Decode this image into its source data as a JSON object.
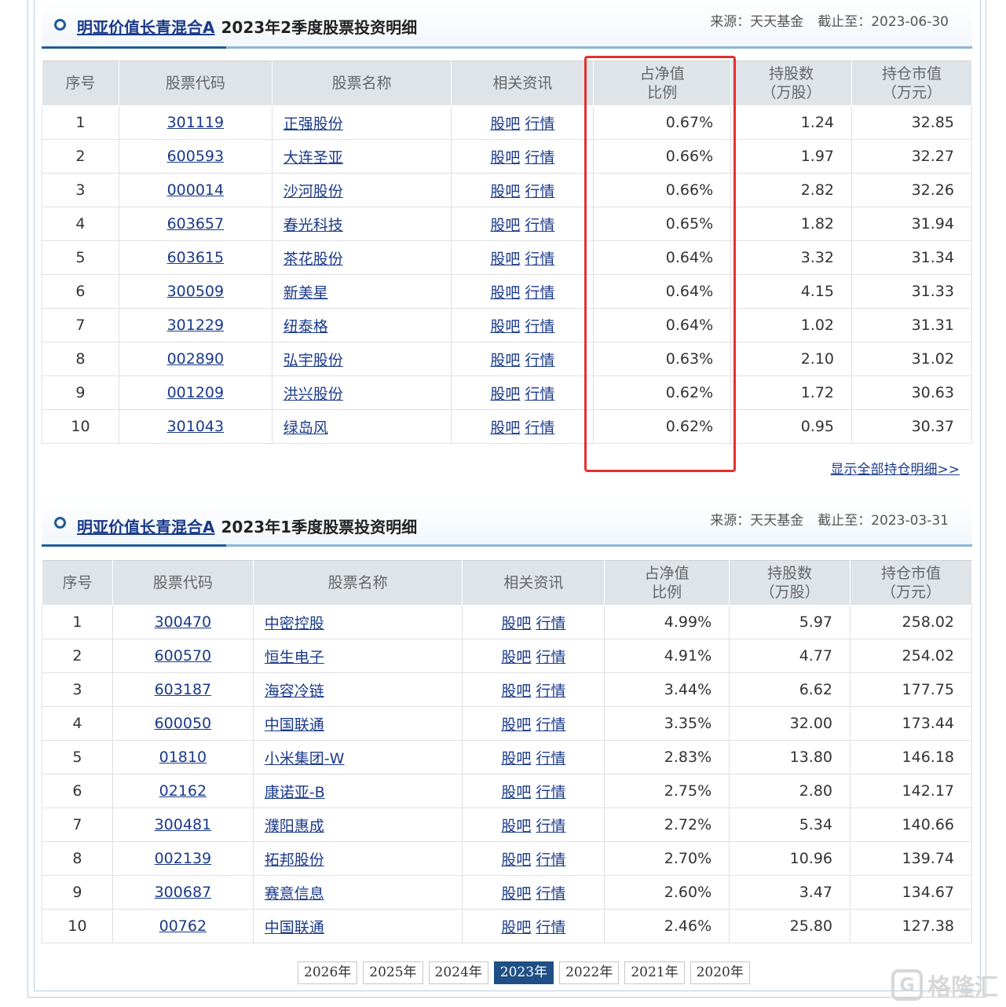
{
  "sections": [
    {
      "fund_name": "明亚价值长青混合A",
      "period": "2023年2季度股票投资明细",
      "source_label": "来源：天天基金",
      "date_label": "截止至：2023-06-30",
      "headers": {
        "seq": "序号",
        "code": "股票代码",
        "name": "股票名称",
        "news": "相关资讯",
        "pct_1": "占净值",
        "pct_2": "比例",
        "shares_1": "持股数",
        "shares_2": "（万股）",
        "value_1": "持仓市值",
        "value_2": "（万元）"
      },
      "news_links": [
        "股吧",
        "行情"
      ],
      "rows": [
        {
          "seq": "1",
          "code": "301119",
          "name": "正强股份",
          "pct": "0.67%",
          "shares": "1.24",
          "value": "32.85"
        },
        {
          "seq": "2",
          "code": "600593",
          "name": "大连圣亚",
          "pct": "0.66%",
          "shares": "1.97",
          "value": "32.27"
        },
        {
          "seq": "3",
          "code": "000014",
          "name": "沙河股份",
          "pct": "0.66%",
          "shares": "2.82",
          "value": "32.26"
        },
        {
          "seq": "4",
          "code": "603657",
          "name": "春光科技",
          "pct": "0.65%",
          "shares": "1.82",
          "value": "31.94"
        },
        {
          "seq": "5",
          "code": "603615",
          "name": "茶花股份",
          "pct": "0.64%",
          "shares": "3.32",
          "value": "31.34"
        },
        {
          "seq": "6",
          "code": "300509",
          "name": "新美星",
          "pct": "0.64%",
          "shares": "4.15",
          "value": "31.33"
        },
        {
          "seq": "7",
          "code": "301229",
          "name": "纽泰格",
          "pct": "0.64%",
          "shares": "1.02",
          "value": "31.31"
        },
        {
          "seq": "8",
          "code": "002890",
          "name": "弘宇股份",
          "pct": "0.63%",
          "shares": "2.10",
          "value": "31.02"
        },
        {
          "seq": "9",
          "code": "001209",
          "name": "洪兴股份",
          "pct": "0.62%",
          "shares": "1.72",
          "value": "30.63"
        },
        {
          "seq": "10",
          "code": "301043",
          "name": "绿岛风",
          "pct": "0.62%",
          "shares": "0.95",
          "value": "30.37"
        }
      ],
      "show_all_label": "显示全部持仓明细>>"
    },
    {
      "fund_name": "明亚价值长青混合A",
      "period": "2023年1季度股票投资明细",
      "source_label": "来源：天天基金",
      "date_label": "截止至：2023-03-31",
      "headers": {
        "seq": "序号",
        "code": "股票代码",
        "name": "股票名称",
        "news": "相关资讯",
        "pct_1": "占净值",
        "pct_2": "比例",
        "shares_1": "持股数",
        "shares_2": "（万股）",
        "value_1": "持仓市值",
        "value_2": "（万元）"
      },
      "news_links": [
        "股吧",
        "行情"
      ],
      "rows": [
        {
          "seq": "1",
          "code": "300470",
          "name": "中密控股",
          "pct": "4.99%",
          "shares": "5.97",
          "value": "258.02"
        },
        {
          "seq": "2",
          "code": "600570",
          "name": "恒生电子",
          "pct": "4.91%",
          "shares": "4.77",
          "value": "254.02"
        },
        {
          "seq": "3",
          "code": "603187",
          "name": "海容冷链",
          "pct": "3.44%",
          "shares": "6.62",
          "value": "177.75"
        },
        {
          "seq": "4",
          "code": "600050",
          "name": "中国联通",
          "pct": "3.35%",
          "shares": "32.00",
          "value": "173.44"
        },
        {
          "seq": "5",
          "code": "01810",
          "name": "小米集团-W",
          "pct": "2.83%",
          "shares": "13.80",
          "value": "146.18"
        },
        {
          "seq": "6",
          "code": "02162",
          "name": "康诺亚-B",
          "pct": "2.75%",
          "shares": "2.80",
          "value": "142.17"
        },
        {
          "seq": "7",
          "code": "300481",
          "name": "濮阳惠成",
          "pct": "2.72%",
          "shares": "5.34",
          "value": "140.66"
        },
        {
          "seq": "8",
          "code": "002139",
          "name": "拓邦股份",
          "pct": "2.70%",
          "shares": "10.96",
          "value": "139.74"
        },
        {
          "seq": "9",
          "code": "300687",
          "name": "赛意信息",
          "pct": "2.60%",
          "shares": "3.47",
          "value": "134.67"
        },
        {
          "seq": "10",
          "code": "00762",
          "name": "中国联通",
          "pct": "2.46%",
          "shares": "25.80",
          "value": "127.38"
        }
      ]
    }
  ],
  "years": [
    "2026年",
    "2025年",
    "2024年",
    "2023年",
    "2022年",
    "2021年",
    "2020年"
  ],
  "active_year": "2023年",
  "highlight_color": "#e53030",
  "accent_color": "#1f4f86",
  "watermark_text": "格隆汇"
}
